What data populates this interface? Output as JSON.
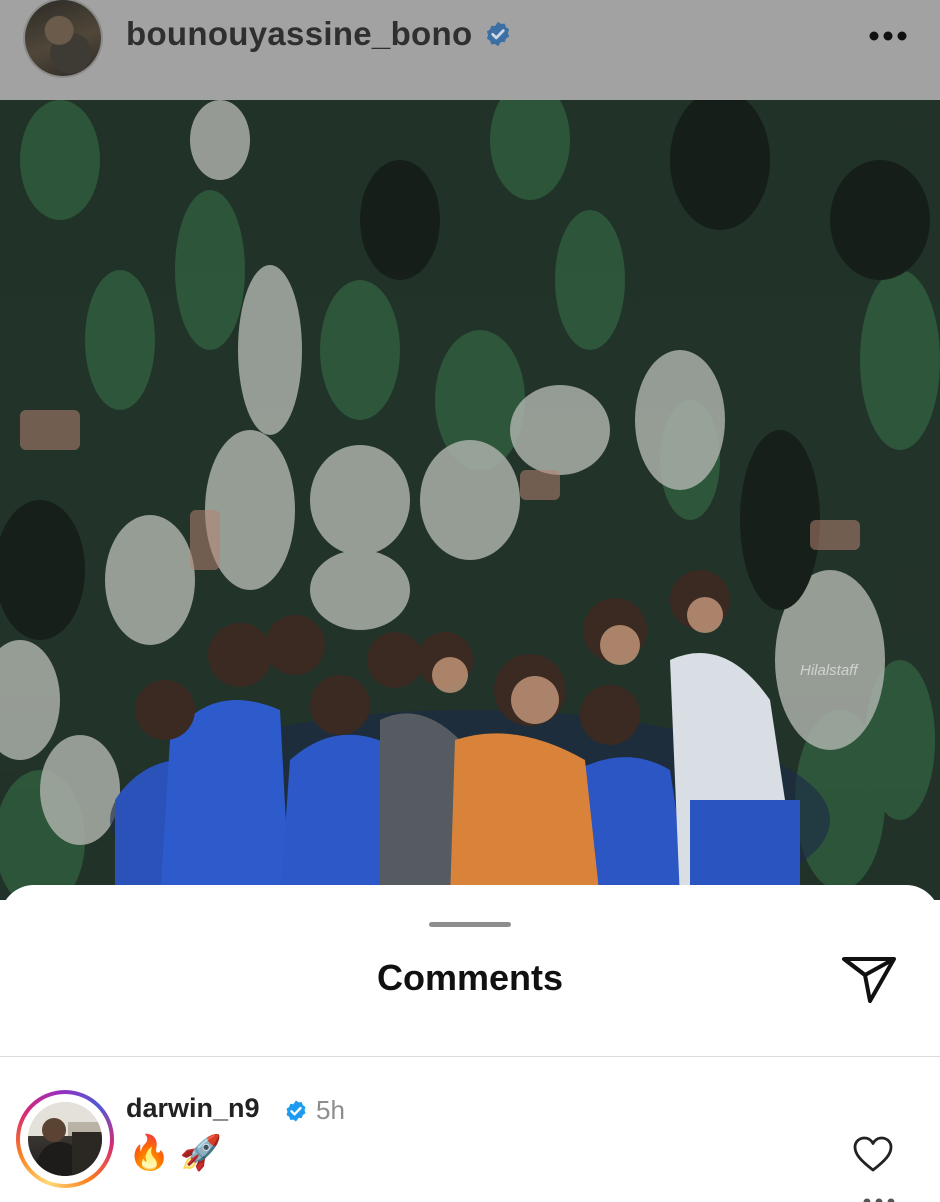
{
  "post": {
    "username": "bounouyassine_bono",
    "avatar_icon": "user-avatar",
    "verified_icon": "verified-badge-icon",
    "more_icon": "more-horizontal-icon",
    "photo_watermark": "Hilalstaff"
  },
  "comments_sheet": {
    "title": "Comments",
    "share_icon": "send-icon",
    "comments": [
      {
        "username": "darwin_n9",
        "verified": true,
        "time": "5h",
        "text": "🔥 🚀",
        "like_icon": "heart-outline-icon"
      }
    ]
  },
  "colors": {
    "verified_blue": "#1d9bf0",
    "dimmed_header": "#a2a2a2",
    "text_primary": "#111111",
    "text_secondary": "#8e8e8e"
  }
}
